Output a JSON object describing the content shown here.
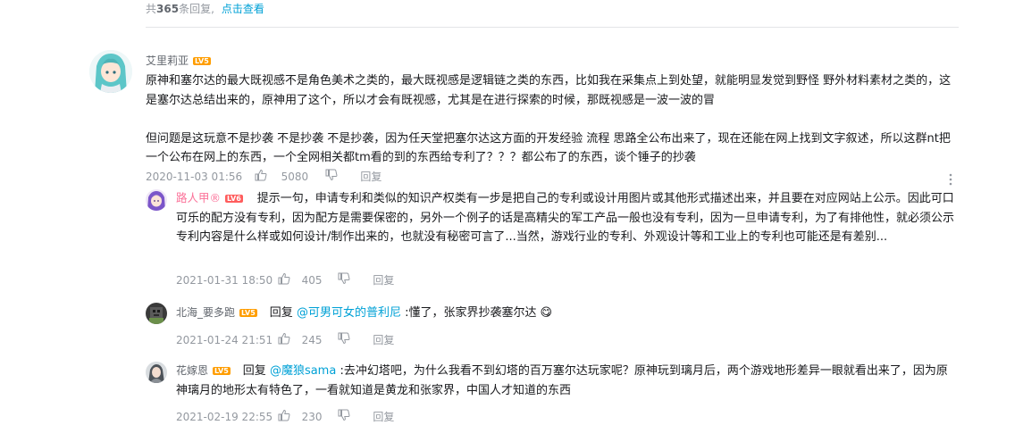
{
  "header": {
    "prefix": "共",
    "count": "365",
    "suffix": "条回复,",
    "view_link": "点击查看"
  },
  "comment": {
    "user": "艾里莉亚",
    "level": "LV5",
    "para1": "原神和塞尔达的最大既视感不是角色美术之类的，最大既视感是逻辑链之类的东西，比如我在采集点上到处望，就能明显发觉到野怪  野外材料素材之类的，这是塞尔达总结出来的，原神用了这个，所以才会有既视感，尤其是在进行探索的时候，那既视感是一波一波的冒",
    "para2": "但问题是这玩意不是抄袭 不是抄袭 不是抄袭，因为任天堂把塞尔达这方面的开发经验  流程  思路全公布出来了，现在还能在网上找到文字叙述，所以这群nt把一个公布在网上的东西，一个全网相关都tm看的到的东西给专利了？？？都公布了的东西，谈个锤子的抄袭",
    "time": "2020-11-03 01:56",
    "likes": "5080",
    "reply_label": "回复",
    "more_icon": "more-vertical-icon"
  },
  "replies": [
    {
      "user": "路人甲®",
      "level": "LV6",
      "name_color": "#fb7299",
      "text": "提示一句，申请专利和类似的知识产权类有一步是把自己的专利或设计用图片或其他形式描述出来，并且要在对应网站上公示。因此可口可乐的配方没有专利，因为配方是需要保密的，另外一个例子的话是高精尖的军工产品一般也没有专利，因为一旦申请专利，为了有排他性，就必须公示专利内容是什么样或如何设计/制作出来的，也就没有秘密可言了...当然，游戏行业的专利、外观设计等和工业上的专利也可能还是有差别...",
      "time": "2021-01-31 18:50",
      "likes": "405",
      "reply_label": "回复"
    },
    {
      "user": "北海_要多跑",
      "level": "LV5",
      "name_color": "#61666d",
      "reply_prefix": "回复",
      "mention": "@可男可女的普利尼",
      "text": ":懂了，张家界抄袭塞尔达",
      "emoji": "😋",
      "time": "2021-01-24 21:51",
      "likes": "245",
      "reply_label": "回复"
    },
    {
      "user": "花嫁恩",
      "level": "LV5",
      "name_color": "#61666d",
      "reply_prefix": "回复",
      "mention": "@魔狼sama",
      "text": ":去冲幻塔吧，为什么我看不到幻塔的百万塞尔达玩家呢？原神玩到璃月后，两个游戏地形差异一眼就看出来了，因为原神璃月的地形太有特色了，一看就知道是黄龙和张家界，中国人才知道的东西",
      "time": "2021-02-19 22:55",
      "likes": "230",
      "reply_label": "回复"
    }
  ],
  "colors": {
    "accent": "#00a1d6",
    "vip_pink": "#fb7299",
    "lv5": "#ff9d00",
    "lv6": "#ff5d5d",
    "meta": "#9499a0"
  }
}
